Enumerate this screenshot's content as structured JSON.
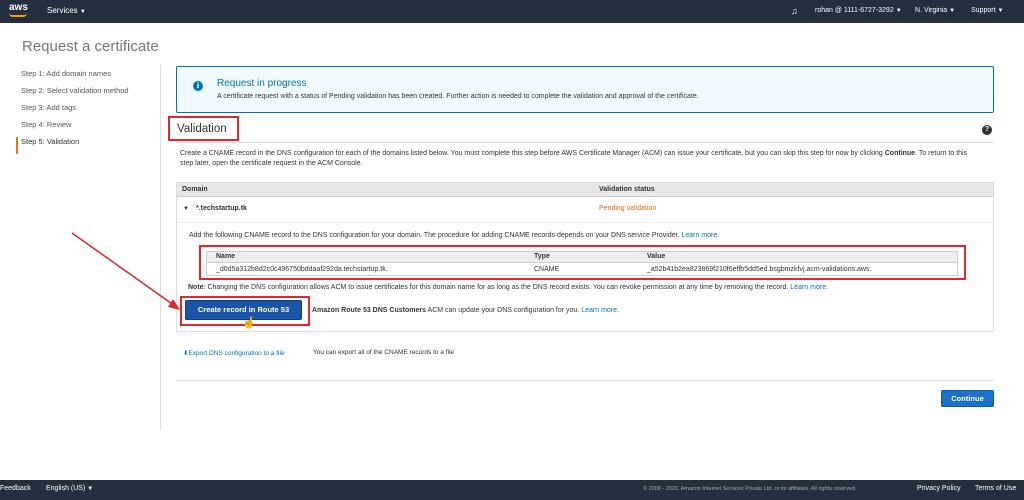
{
  "topnav": {
    "logo_text": "aws",
    "services": "Services",
    "account": "rohan @ 1111-6727-3292",
    "region": "N. Virginia",
    "support": "Support"
  },
  "page_title": "Request a certificate",
  "steps": [
    {
      "label": "Step 1: Add domain names"
    },
    {
      "label": "Step 2: Select validation method"
    },
    {
      "label": "Step 3: Add tags"
    },
    {
      "label": "Step 4: Review"
    },
    {
      "label": "Step 5: Validation",
      "active": true
    }
  ],
  "info": {
    "title": "Request in progress",
    "desc": "A certificate request with a status of Pending validation has been created. Further action is needed to complete the validation and approval of the certificate."
  },
  "validation": {
    "heading": "Validation",
    "intro_1": "Create a CNAME record in the DNS configuration for each of the domains listed below. You must complete this step before AWS Certificate Manager (ACM) can issue your certificate, but you can skip this step for now by clicking",
    "intro_bold": "Continue",
    "intro_2": ". To return to this step later, open the certificate request in the ACM Console."
  },
  "domain_table": {
    "col_domain": "Domain",
    "col_status": "Validation status",
    "domain": "*.techstartup.tk",
    "status": "Pending validation",
    "add_text": "Add the following CNAME record to the DNS configuration for your domain. The procedure for adding CNAME records depends on your DNS service Provider.",
    "learn_more": "Learn more."
  },
  "cname": {
    "col_name": "Name",
    "col_type": "Type",
    "col_value": "Value",
    "name": "_d0d5a312b8d2c0c496750bddaaf292da.techstartup.tk.",
    "type": "CNAME",
    "value": "_a52b41b2ea823869f210f6effb5dd5ed.bsgbmzkfvj.acm-validations.aws."
  },
  "note": {
    "label": "Note",
    "text": ": Changing the DNS configuration allows ACM to issue certificates for this domain name for as long as the DNS record exists. You can revoke permission at any time by removing the record.",
    "learn_more": "Learn more."
  },
  "route53": {
    "button": "Create record in Route 53",
    "bold": "Amazon Route 53 DNS Customers",
    "text": " ACM can update your DNS configuration for you.",
    "learn_more": "Learn more."
  },
  "export": {
    "link": "Export DNS configuration to a file",
    "text": "You can export all of the CNAME records to a file"
  },
  "continue": "Continue",
  "footer": {
    "feedback": "Feedback",
    "language": "English (US)",
    "copyright": "© 2008 - 2020, Amazon Internet Services Private Ltd. or its affiliates. All rights reserved.",
    "privacy": "Privacy Policy",
    "terms": "Terms of Use"
  },
  "colors": {
    "nav_bg": "#232f3e",
    "accent_blue": "#0073bb",
    "annotation_red": "#e0262e",
    "pending_orange": "#dd6b10"
  }
}
